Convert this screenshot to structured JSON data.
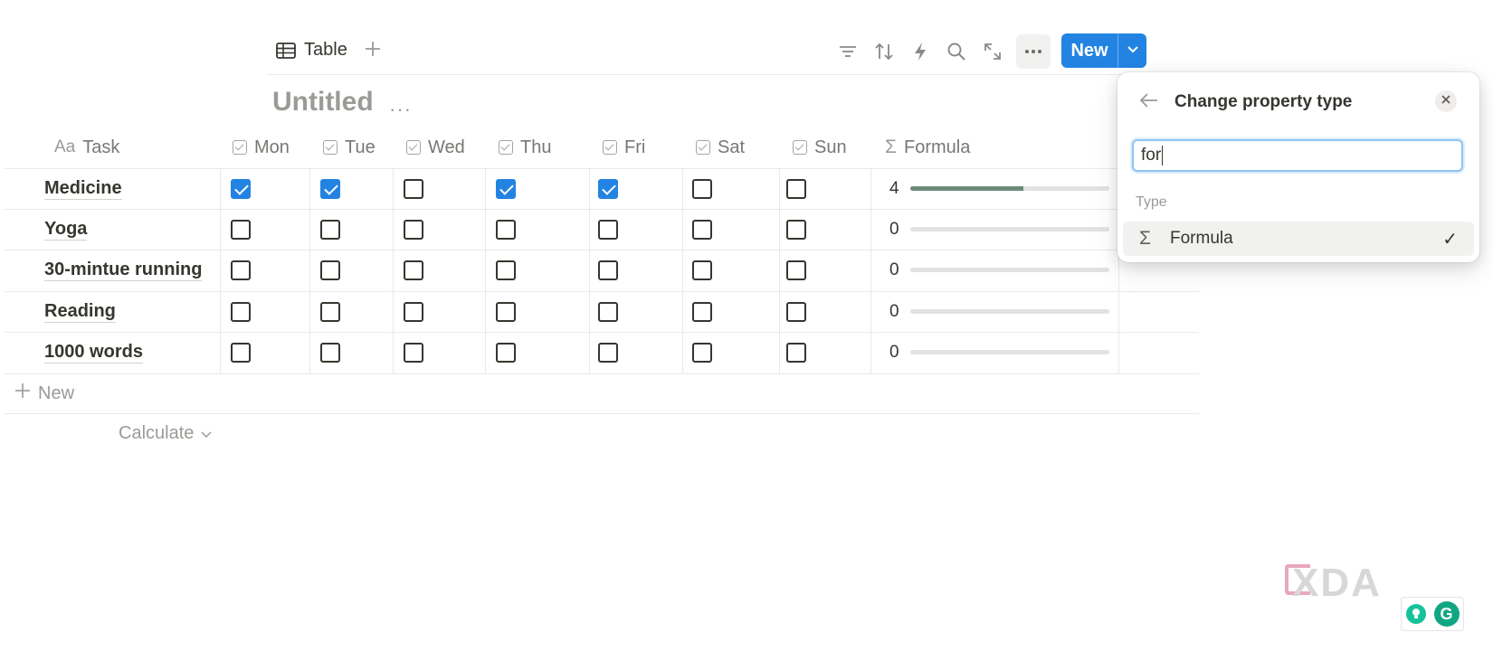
{
  "toolbar": {
    "view_label": "Table",
    "new_label": "New",
    "icons": [
      "table-icon",
      "plus-icon",
      "filter-icon",
      "sort-icon",
      "lightning-icon",
      "search-icon",
      "expand-icon",
      "more-icon",
      "chevron-down-icon"
    ]
  },
  "database": {
    "title": "Untitled",
    "title_more": "···"
  },
  "columns": [
    {
      "label": "Task",
      "icon": "Aa"
    },
    {
      "label": "Mon",
      "icon": "checkbox"
    },
    {
      "label": "Tue",
      "icon": "checkbox"
    },
    {
      "label": "Wed",
      "icon": "checkbox"
    },
    {
      "label": "Thu",
      "icon": "checkbox"
    },
    {
      "label": "Fri",
      "icon": "checkbox"
    },
    {
      "label": "Sat",
      "icon": "checkbox"
    },
    {
      "label": "Sun",
      "icon": "checkbox"
    },
    {
      "label": "Formula",
      "icon": "Σ"
    }
  ],
  "rows": [
    {
      "task": "Medicine",
      "checks": [
        true,
        true,
        false,
        true,
        true,
        false,
        false
      ],
      "formula": "4",
      "progress": 0.57
    },
    {
      "task": "Yoga",
      "checks": [
        false,
        false,
        false,
        false,
        false,
        false,
        false
      ],
      "formula": "0",
      "progress": 0
    },
    {
      "task": "30-mintue running",
      "checks": [
        false,
        false,
        false,
        false,
        false,
        false,
        false
      ],
      "formula": "0",
      "progress": 0
    },
    {
      "task": "Reading",
      "checks": [
        false,
        false,
        false,
        false,
        false,
        false,
        false
      ],
      "formula": "0",
      "progress": 0
    },
    {
      "task": "1000 words",
      "checks": [
        false,
        false,
        false,
        false,
        false,
        false,
        false
      ],
      "formula": "0",
      "progress": 0
    }
  ],
  "footer": {
    "new_label": "New",
    "calculate_label": "Calculate"
  },
  "popup": {
    "title": "Change property type",
    "search_value": "for",
    "section_label": "Type",
    "option_icon": "Σ",
    "option_label": "Formula",
    "option_check": "✓"
  },
  "watermark": {
    "brand": "XDA",
    "grammarly_letter": "G"
  },
  "colors": {
    "accent": "#2383e2",
    "progress_fill": "#6e8b7a"
  }
}
